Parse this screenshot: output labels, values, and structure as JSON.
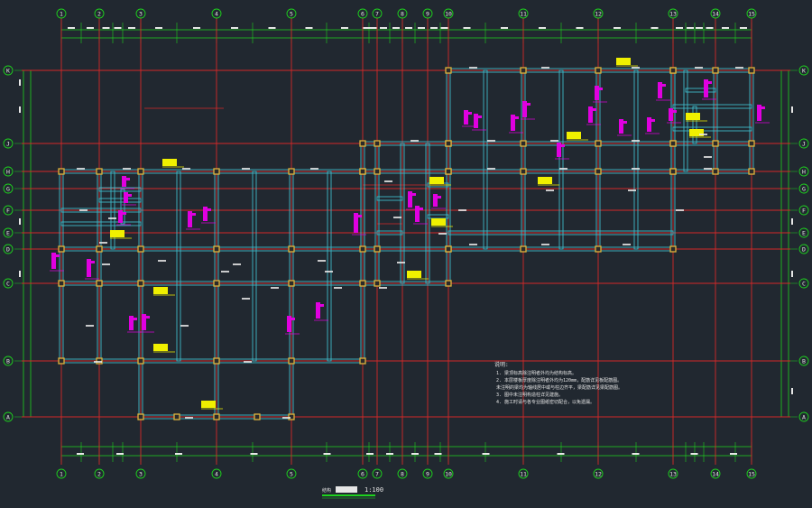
{
  "drawing": {
    "background": "#212830",
    "colors": {
      "axis": "#d42828",
      "dim": "#1ed21e",
      "beam": "#3fb9c8",
      "column": "#e0b43c",
      "yellow_tag": "#f0f000",
      "magenta_tag": "#e000e0",
      "white_text": "#e6e6e6"
    },
    "x_axes": [
      "1",
      "2",
      "3",
      "4",
      "5",
      "6",
      "7",
      "8",
      "9",
      "10",
      "11",
      "12",
      "13",
      "14",
      "15"
    ],
    "x_axes_top_labels": [
      "1",
      "2",
      "3",
      "4",
      "5",
      "6",
      "7",
      "8",
      "9",
      "10",
      "11",
      "12",
      "13",
      "14",
      "15"
    ],
    "y_axes": [
      "K",
      "J",
      "H",
      "G",
      "F",
      "E",
      "D",
      "C",
      "B",
      "A"
    ],
    "scale_label": "1:100",
    "scale_title": "结构",
    "notes_heading": "说明:",
    "notes": [
      "1. 梁顶标高除注明者外均为结构标高。",
      "2. 本层楼板厚度除注明者外均为120mm，配筋详见板配筋图。",
      "   未注明的梁均为轴线居中或与柱边齐平，梁配筋详见梁配筋图。",
      "3. 图中未注明构造柱详见建施。",
      "4. 施工时请与各专业图纸密切配合，以免遗漏。"
    ]
  }
}
